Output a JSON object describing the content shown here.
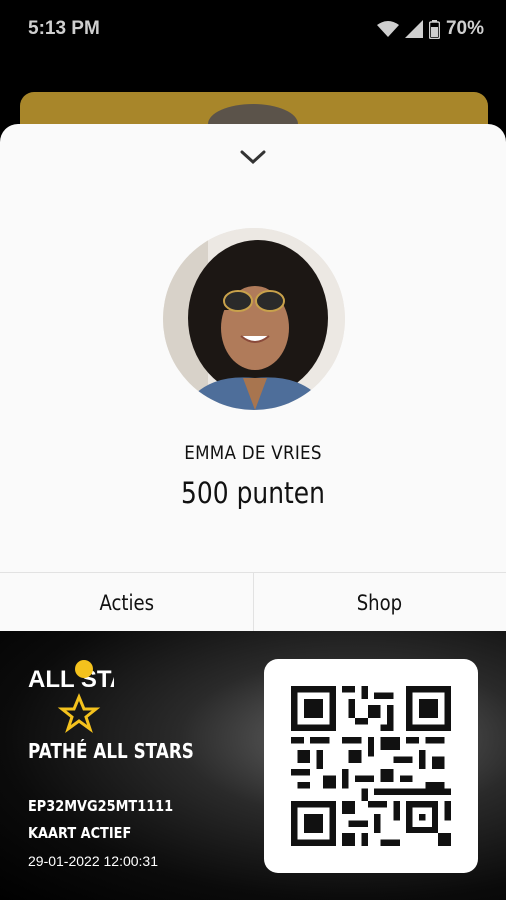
{
  "status_bar": {
    "time": "5:13 PM",
    "battery": "70%"
  },
  "profile": {
    "name": "EMMA DE VRIES",
    "points": "500 punten"
  },
  "tabs": [
    {
      "label": "Acties"
    },
    {
      "label": "Shop"
    }
  ],
  "card": {
    "logo_text": "ALL STARS",
    "title": "PATHÉ ALL STARS",
    "code": "EP32MVG25MT1111",
    "status": "KAART ACTIEF",
    "date": "29-01-2022 12:00:31"
  },
  "colors": {
    "gold": "#a8862a",
    "accent_yellow": "#f4c21d",
    "sheet_bg": "#fafafa"
  },
  "icons": [
    "wifi-icon",
    "signal-icon",
    "battery-icon",
    "chevron-down-icon",
    "qr-code-icon"
  ]
}
